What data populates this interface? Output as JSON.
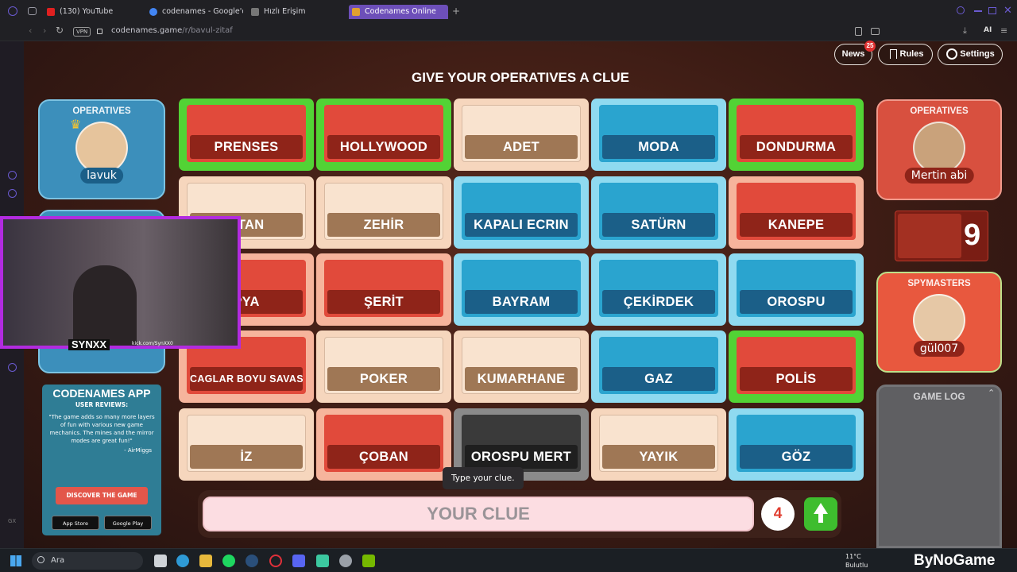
{
  "browser": {
    "tabs": [
      {
        "label": "(130) YouTube",
        "color": "#e02020"
      },
      {
        "label": "codenames - Google'da A",
        "color": "#4285f4"
      },
      {
        "label": "Hızlı Erişim",
        "color": "#777777"
      },
      {
        "label": "Codenames Online",
        "color": "#e0a030",
        "active": true
      }
    ],
    "url_domain": "codenames.game",
    "url_path": "/r/bavul-zitaf",
    "vpn_label": "VPN",
    "ai_label": "AI"
  },
  "header": {
    "news_label": "News",
    "news_badge": "25",
    "rules_label": "Rules",
    "settings_label": "Settings",
    "banner": "GIVE YOUR OPERATIVES A CLUE"
  },
  "blue_team": {
    "operatives_title": "OPERATIVES",
    "operative": "lavuk"
  },
  "red_team": {
    "operatives_title": "OPERATIVES",
    "operative": "Mertin abi",
    "remaining": "9",
    "spymasters_title": "SPYMASTERS",
    "spymaster": "gül007"
  },
  "board": {
    "cards": [
      {
        "word": "PRENSES",
        "type": "red",
        "selected": true
      },
      {
        "word": "HOLLYWOOD",
        "type": "red",
        "selected": true
      },
      {
        "word": "ADET",
        "type": "neutral",
        "selected": false
      },
      {
        "word": "MODA",
        "type": "blue",
        "selected": false
      },
      {
        "word": "DONDURMA",
        "type": "red",
        "selected": true
      },
      {
        "word": "PTAN",
        "type": "neutral",
        "selected": false
      },
      {
        "word": "ZEHİR",
        "type": "neutral",
        "selected": false
      },
      {
        "word": "KAPALI ECRIN",
        "type": "blue",
        "selected": false
      },
      {
        "word": "SATÜRN",
        "type": "blue",
        "selected": false
      },
      {
        "word": "KANEPE",
        "type": "red",
        "selected": false
      },
      {
        "word": "PYA",
        "type": "red",
        "selected": false
      },
      {
        "word": "ŞERİT",
        "type": "red",
        "selected": false
      },
      {
        "word": "BAYRAM",
        "type": "blue",
        "selected": false
      },
      {
        "word": "ÇEKİRDEK",
        "type": "blue",
        "selected": false
      },
      {
        "word": "OROSPU",
        "type": "blue",
        "selected": false
      },
      {
        "word": "CAGLAR BOYU SAVAS",
        "type": "red",
        "selected": false
      },
      {
        "word": "POKER",
        "type": "neutral",
        "selected": false
      },
      {
        "word": "KUMARHANE",
        "type": "neutral",
        "selected": false
      },
      {
        "word": "GAZ",
        "type": "blue",
        "selected": false
      },
      {
        "word": "POLİS",
        "type": "red",
        "selected": true
      },
      {
        "word": "İZ",
        "type": "neutral",
        "selected": false
      },
      {
        "word": "ÇOBAN",
        "type": "red",
        "selected": false
      },
      {
        "word": "OROSPU MERT",
        "type": "assassin",
        "selected": false
      },
      {
        "word": "YAYIK",
        "type": "neutral",
        "selected": false
      },
      {
        "word": "GÖZ",
        "type": "blue",
        "selected": false
      }
    ]
  },
  "clue": {
    "placeholder": "YOUR CLUE",
    "tooltip": "Type your clue.",
    "number": "4"
  },
  "game_log": {
    "title": "GAME LOG"
  },
  "promo": {
    "title": "CODENAMES APP",
    "subtitle": "USER REVIEWS:",
    "quote": "\"The game adds so many more layers of fun with various new game mechanics. The mines and the mirror modes are great fun!\"",
    "author": "- AirMiggs",
    "button": "DISCOVER THE GAME",
    "app_store": "App Store",
    "google_play": "Google Play"
  },
  "webcam": {
    "name": "SYNXX",
    "subtitle": "kick.com/SynXX0"
  },
  "taskbar": {
    "search_label": "Ara",
    "weather_temp": "11°C",
    "weather_desc": "Bulutlu",
    "watermark": "ByNoGame"
  },
  "colors": {
    "red": "#e14a3b",
    "blue": "#2aa4cf",
    "neutral": "#f9e3cf",
    "assassin": "#3a3a3a",
    "selected": "#52d335"
  }
}
